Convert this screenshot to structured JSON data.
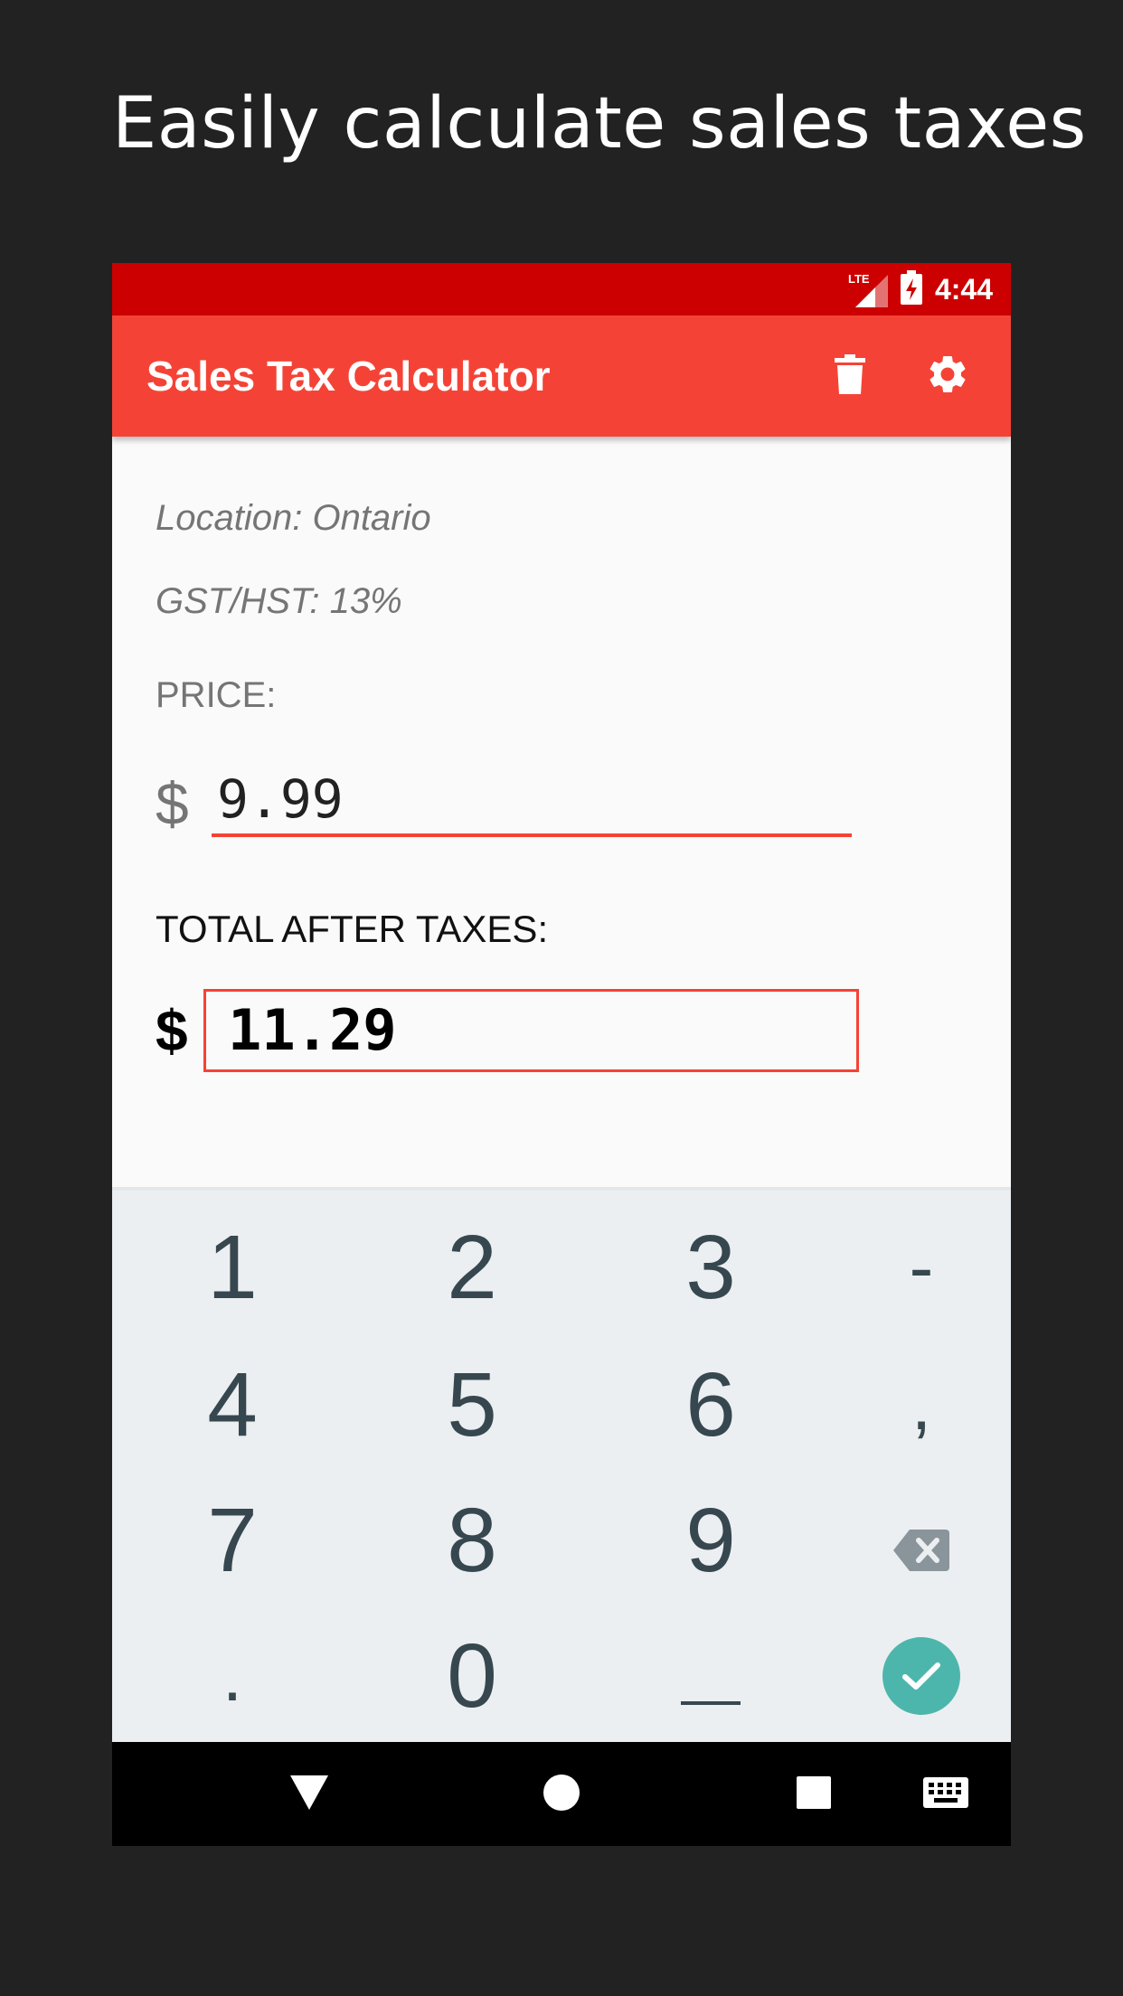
{
  "headline": "Easily calculate sales taxes",
  "status": {
    "network": "LTE",
    "time": "4:44"
  },
  "appbar": {
    "title": "Sales Tax Calculator",
    "bg": "#f44336",
    "status_bg": "#cc0000"
  },
  "content": {
    "location": "Location: Ontario",
    "tax_rate": "GST/HST: 13%",
    "price_label": "PRICE:",
    "currency": "$",
    "price_value": "9.99",
    "total_label": "TOTAL AFTER TAXES:",
    "total_value": "11.29"
  },
  "keyboard": {
    "keys": [
      "1",
      "2",
      "3",
      "-",
      "4",
      "5",
      "6",
      ",",
      "7",
      "8",
      "9",
      "⌫",
      ".",
      "0",
      "_",
      "✓"
    ],
    "confirm_color": "#4db6ac"
  },
  "icons": [
    "delete-icon",
    "settings-icon",
    "lte-signal-icon",
    "battery-charging-icon",
    "backspace-icon",
    "check-icon",
    "nav-back-icon",
    "nav-home-icon",
    "nav-recents-icon",
    "keyboard-icon"
  ]
}
